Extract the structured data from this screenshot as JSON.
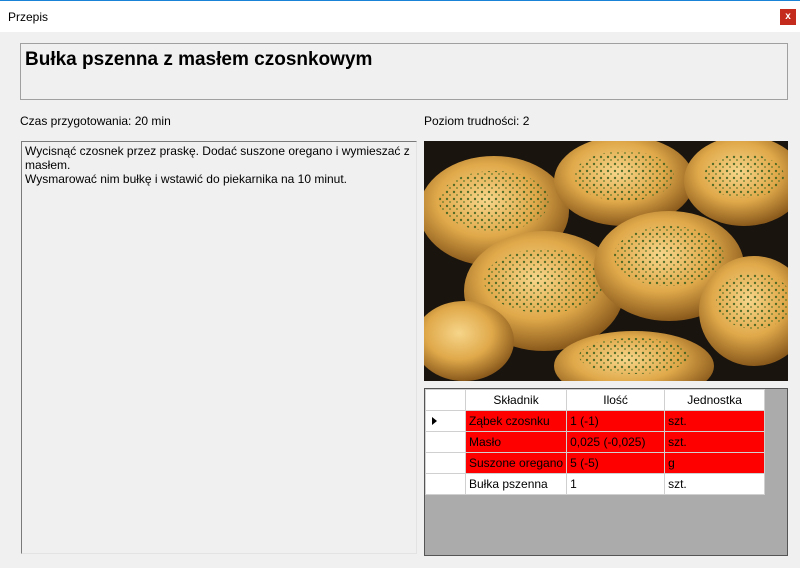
{
  "window": {
    "title": "Przepis",
    "close_label": "x"
  },
  "recipe": {
    "name": "Bułka pszenna z masłem czosnkowym",
    "prep_time": "Czas przygotowania: 20 min",
    "difficulty": "Poziom trudności: 2",
    "description": "Wycisnąć czosnek przez praskę. Dodać suszone oregano i wymieszać z masłem.\nWysmarować nim bułkę i wstawić do piekarnika na 10 minut."
  },
  "ingredients": {
    "columns": [
      "Składnik",
      "Ilość",
      "Jednostka"
    ],
    "rows": [
      {
        "name": "Ząbek czosnku",
        "qty": "1 (-1)",
        "unit": "szt.",
        "missing": true
      },
      {
        "name": "Masło",
        "qty": "0,025 (-0,025)",
        "unit": "szt.",
        "missing": true
      },
      {
        "name": "Suszone oregano",
        "qty": "5 (-5)",
        "unit": "g",
        "missing": true
      },
      {
        "name": "Bułka pszenna",
        "qty": "1",
        "unit": "szt.",
        "missing": false
      }
    ]
  },
  "colors": {
    "missing_row": "#ff0000",
    "accent": "#1883d7"
  }
}
